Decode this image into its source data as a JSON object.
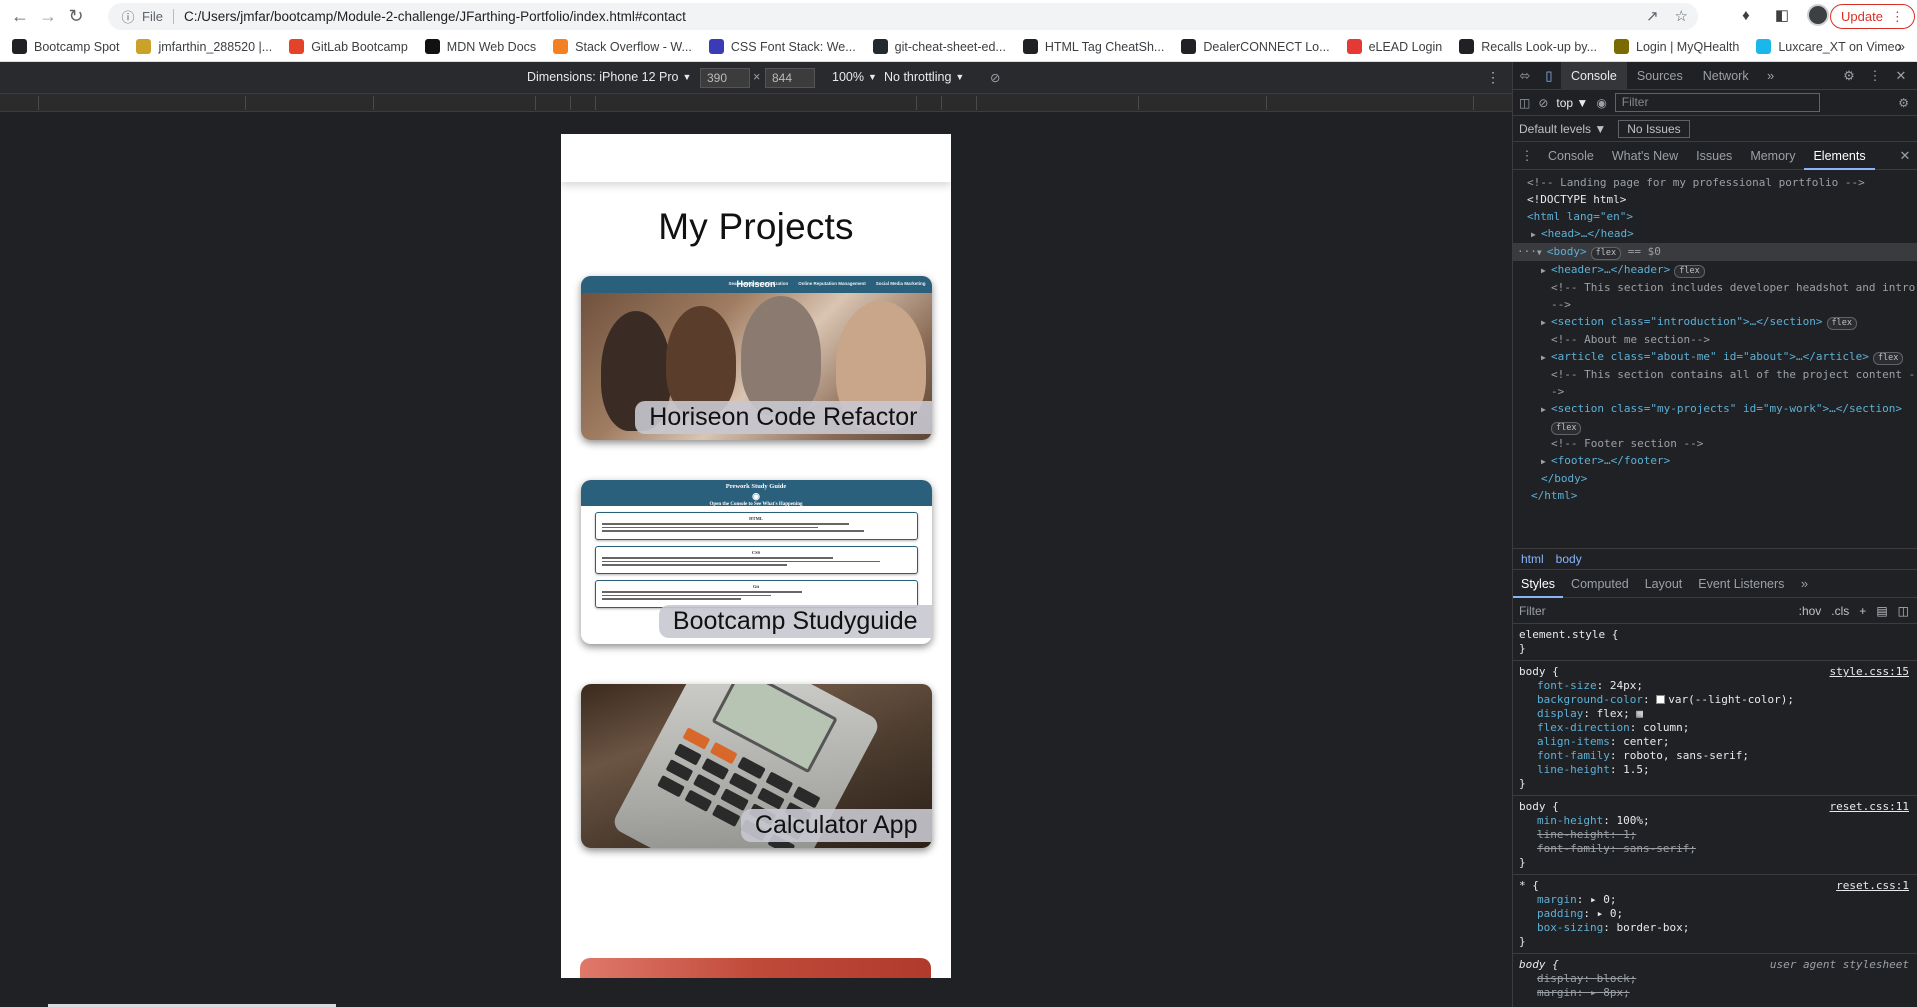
{
  "browser": {
    "scheme": "File",
    "url": "C:/Users/jmfar/bootcamp/Module-2-challenge/JFarthing-Portfolio/index.html#contact",
    "update_label": "Update"
  },
  "bookmarks": [
    {
      "label": "Bootcamp Spot",
      "color": "#202124"
    },
    {
      "label": "jmfarthin_288520 |...",
      "color": "#c9a227"
    },
    {
      "label": "GitLab Bootcamp",
      "color": "#e24329"
    },
    {
      "label": "MDN Web Docs",
      "color": "#111111"
    },
    {
      "label": "Stack Overflow - W...",
      "color": "#f48024"
    },
    {
      "label": "CSS Font Stack: We...",
      "color": "#3b3bb5"
    },
    {
      "label": "git-cheat-sheet-ed...",
      "color": "#24292e"
    },
    {
      "label": "HTML Tag CheatSh...",
      "color": "#202124"
    },
    {
      "label": "DealerCONNECT Lo...",
      "color": "#202124"
    },
    {
      "label": "eLEAD Login",
      "color": "#e53935"
    },
    {
      "label": "Recalls Look-up by...",
      "color": "#202124"
    },
    {
      "label": "Login | MyQHealth",
      "color": "#7a6a00"
    },
    {
      "label": "Luxcare_XT on Vimeo",
      "color": "#1ab7ea"
    }
  ],
  "device_toolbar": {
    "dimensions": "Dimensions: iPhone 12 Pro",
    "width": "390",
    "height": "844",
    "zoom": "100%",
    "throttling": "No throttling"
  },
  "page": {
    "heading": "My Projects",
    "projects": [
      {
        "label": "Horiseon Code Refactor"
      },
      {
        "label": "Bootcamp Studyguide"
      },
      {
        "label": "Calculator App"
      }
    ],
    "horiseon_brand": "Horiseon",
    "horiseon_nav": [
      "Search Engine Optimization",
      "Online Reputation Management",
      "Social Media Marketing"
    ],
    "studyguide_title": "Prework Study Guide",
    "studyguide_subtitle": "Open the Console to See What's Happening",
    "studyguide_sections": [
      "HTML",
      "CSS",
      "Git"
    ]
  },
  "devtools": {
    "top_tabs": [
      "Console",
      "Sources",
      "Network"
    ],
    "context": "top",
    "filter_placeholder": "Filter",
    "levels": "Default levels",
    "issues": "No Issues",
    "drawer_tabs": [
      "Console",
      "What's New",
      "Issues",
      "Memory",
      "Elements"
    ],
    "dom": {
      "comment1": "<!-- Landing page for my professional portfolio -->",
      "doctype": "<!DOCTYPE html>",
      "html_open": "<html lang=\"en\">",
      "head": "<head>…</head>",
      "body": "<body>",
      "body_suffix": "== $0",
      "header": "<header>…</header>",
      "comment2": "<!-- This section includes developer headshot and intro",
      "comment2_end": "-->",
      "intro": "<section class=\"introduction\">…</section>",
      "comment3": "<!-- About me section-->",
      "about": "<article class=\"about-me\" id=\"about\">…</article>",
      "comment4": "<!-- This section contains all of the project content -",
      "comment4_end": "->",
      "projects": "<section class=\"my-projects\" id=\"my-work\">…</section>",
      "comment5": "<!-- Footer section -->",
      "footer": "<footer>…</footer>",
      "body_close": "</body>",
      "html_close": "</html>",
      "flex": "flex"
    },
    "breadcrumbs": [
      "html",
      "body"
    ],
    "style_tabs": [
      "Styles",
      "Computed",
      "Layout",
      "Event Listeners"
    ],
    "style_filter": "Filter",
    "style_tools": [
      ":hov",
      ".cls",
      "+"
    ],
    "rules": {
      "element_style": "element.style {",
      "close": "}",
      "body1_selector": "body {",
      "body1_src": "style.css:15",
      "body1_decls": [
        {
          "prop": "font-size",
          "val": "24px;"
        },
        {
          "prop": "background-color",
          "val": "var(--light-color);"
        },
        {
          "prop": "display",
          "val": "flex;"
        },
        {
          "prop": "flex-direction",
          "val": "column;"
        },
        {
          "prop": "align-items",
          "val": "center;"
        },
        {
          "prop": "font-family",
          "val": "roboto, sans-serif;"
        },
        {
          "prop": "line-height",
          "val": "1.5;"
        }
      ],
      "body2_selector": "body {",
      "body2_src": "reset.css:11",
      "body2_decls": [
        {
          "prop": "min-height",
          "val": "100%;"
        },
        {
          "prop": "line-height",
          "val": "1;"
        },
        {
          "prop": "font-family",
          "val": "sans-serif;"
        }
      ],
      "star_selector": "* {",
      "star_src": "reset.css:1",
      "star_decls": [
        {
          "prop": "margin",
          "val": "0;"
        },
        {
          "prop": "padding",
          "val": "0;"
        },
        {
          "prop": "box-sizing",
          "val": "border-box;"
        }
      ],
      "ua_selector": "body {",
      "ua_src": "user agent stylesheet",
      "ua_decls": [
        {
          "prop": "display",
          "val": "block;"
        },
        {
          "prop": "margin",
          "val": "8px;"
        }
      ]
    }
  }
}
